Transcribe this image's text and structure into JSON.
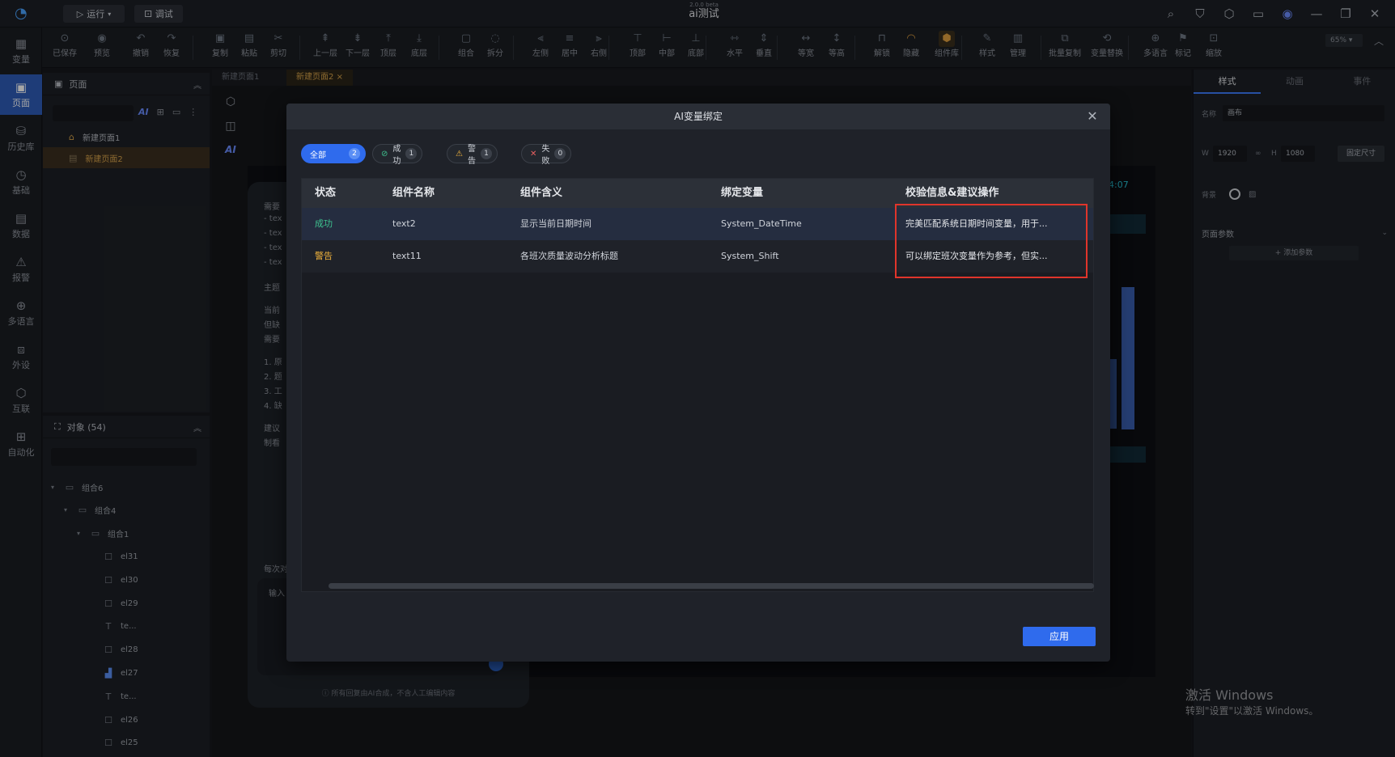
{
  "titlebar": {
    "version": "2.0.0 beta",
    "title": "ai测试",
    "run_label": "运行",
    "debug_label": "调试"
  },
  "toolbar": [
    {
      "label": "已保存",
      "icon": "save-icon"
    },
    {
      "label": "预览",
      "icon": "preview-icon"
    },
    {
      "label": "撤销",
      "icon": "undo-icon"
    },
    {
      "label": "恢复",
      "icon": "redo-icon"
    },
    {
      "label": "复制",
      "icon": "copy-icon"
    },
    {
      "label": "粘贴",
      "icon": "paste-icon"
    },
    {
      "label": "剪切",
      "icon": "cut-icon"
    },
    {
      "label": "上一层",
      "icon": "layer-up-icon"
    },
    {
      "label": "下一层",
      "icon": "layer-down-icon"
    },
    {
      "label": "顶层",
      "icon": "layer-top-icon"
    },
    {
      "label": "底层",
      "icon": "layer-bottom-icon"
    },
    {
      "label": "组合",
      "icon": "group-icon"
    },
    {
      "label": "拆分",
      "icon": "ungroup-icon"
    },
    {
      "label": "左侧",
      "icon": "align-left-icon"
    },
    {
      "label": "居中",
      "icon": "align-center-icon"
    },
    {
      "label": "右侧",
      "icon": "align-right-icon"
    },
    {
      "label": "顶部",
      "icon": "align-top-icon"
    },
    {
      "label": "中部",
      "icon": "align-middle-icon"
    },
    {
      "label": "底部",
      "icon": "align-bottom-icon"
    },
    {
      "label": "水平",
      "icon": "distribute-h-icon"
    },
    {
      "label": "垂直",
      "icon": "distribute-v-icon"
    },
    {
      "label": "等宽",
      "icon": "same-width-icon"
    },
    {
      "label": "等高",
      "icon": "same-height-icon"
    },
    {
      "label": "解锁",
      "icon": "unlock-icon"
    },
    {
      "label": "隐藏",
      "icon": "hide-icon"
    },
    {
      "label": "组件库",
      "icon": "component-lib-icon"
    },
    {
      "label": "样式",
      "icon": "style-icon"
    },
    {
      "label": "管理",
      "icon": "manage-icon"
    },
    {
      "label": "批量复制",
      "icon": "batch-copy-icon"
    },
    {
      "label": "变量替换",
      "icon": "var-replace-icon"
    },
    {
      "label": "多语言",
      "icon": "language-icon"
    },
    {
      "label": "标记",
      "icon": "mark-icon"
    },
    {
      "label": "缩放",
      "icon": "zoom-icon"
    }
  ],
  "zoom": "65%",
  "left_rail": [
    {
      "label": "变量",
      "icon": "variable-icon"
    },
    {
      "label": "页面",
      "icon": "page-icon"
    },
    {
      "label": "历史库",
      "icon": "history-icon"
    },
    {
      "label": "基础",
      "icon": "basic-icon"
    },
    {
      "label": "数据",
      "icon": "data-icon"
    },
    {
      "label": "报警",
      "icon": "alarm-icon"
    },
    {
      "label": "多语言",
      "icon": "language-icon"
    },
    {
      "label": "外设",
      "icon": "peripheral-icon"
    },
    {
      "label": "互联",
      "icon": "interconnect-icon"
    },
    {
      "label": "自动化",
      "icon": "automation-icon"
    }
  ],
  "pages_panel": {
    "title": "页面",
    "ai_label": "AI",
    "pages": [
      "新建页面1",
      "新建页面2"
    ]
  },
  "objects_panel": {
    "title": "对象 (54)",
    "tree": [
      {
        "label": "组合6",
        "level": 0,
        "icon": "folder-icon",
        "chev": "▾"
      },
      {
        "label": "组合4",
        "level": 1,
        "icon": "folder-icon",
        "chev": "▾"
      },
      {
        "label": "组合1",
        "level": 2,
        "icon": "folder-icon",
        "chev": "▾"
      },
      {
        "label": "el31",
        "level": 3,
        "icon": "rect-icon",
        "chev": ""
      },
      {
        "label": "el30",
        "level": 3,
        "icon": "rect-icon",
        "chev": ""
      },
      {
        "label": "el29",
        "level": 3,
        "icon": "rect-icon",
        "chev": ""
      },
      {
        "label": "te...",
        "level": 3,
        "icon": "text-icon",
        "chev": ""
      },
      {
        "label": "el28",
        "level": 3,
        "icon": "rect-icon",
        "chev": ""
      },
      {
        "label": "el27",
        "level": 3,
        "icon": "chart-icon",
        "chev": ""
      },
      {
        "label": "te...",
        "level": 3,
        "icon": "text-icon",
        "chev": ""
      },
      {
        "label": "el26",
        "level": 3,
        "icon": "rect-icon",
        "chev": ""
      },
      {
        "label": "el25",
        "level": 3,
        "icon": "rect-icon",
        "chev": ""
      }
    ]
  },
  "page_tabs": [
    {
      "label": "新建页面1",
      "active": false
    },
    {
      "label": "新建页面2",
      "active": true
    }
  ],
  "ai_chat": {
    "lines": [
      "需要",
      "- tex",
      "- tex",
      "- tex",
      "- tex",
      "主题",
      "当前",
      "但缺",
      "需要",
      "1. 原",
      "2. 题",
      "3. 工",
      "4. 缺",
      "建议",
      "制看"
    ],
    "side_text": "每次对",
    "input_placeholder": "输入",
    "footer": "ⓘ 所有回复由AI合成，不含人工编辑内容"
  },
  "background_time": "4:07",
  "right_panel": {
    "tabs": [
      "样式",
      "动画",
      "事件"
    ],
    "name_label": "名称",
    "name_value": "画布",
    "w_label": "W",
    "w_value": "1920",
    "h_label": "H",
    "h_value": "1080",
    "lock_icon": "link-icon",
    "fixed_size_label": "固定尺寸",
    "bg_label": "背景",
    "page_params_label": "页面参数",
    "add_param_label": "+ 添加参数"
  },
  "watermark": {
    "line1": "激活 Windows",
    "line2": "转到\"设置\"以激活 Windows。"
  },
  "modal": {
    "title": "AI变量绑定",
    "filters": [
      {
        "label": "全部",
        "count": "2",
        "active": true,
        "kind": "all"
      },
      {
        "label": "成功",
        "count": "1",
        "active": false,
        "kind": "success"
      },
      {
        "label": "警告",
        "count": "1",
        "active": false,
        "kind": "warning"
      },
      {
        "label": "失败",
        "count": "0",
        "active": false,
        "kind": "fail"
      }
    ],
    "columns": [
      "状态",
      "组件名称",
      "组件含义",
      "绑定变量",
      "校验信息&建议操作"
    ],
    "rows": [
      {
        "status": "成功",
        "status_kind": "success",
        "name": "text2",
        "meaning": "显示当前日期时间",
        "variable": "System_DateTime",
        "message": "完美匹配系统日期时间变量，用于..."
      },
      {
        "status": "警告",
        "status_kind": "warning",
        "name": "text11",
        "meaning": "各班次质量波动分析标题",
        "variable": "System_Shift",
        "message": "可以绑定班次变量作为参考，但实..."
      }
    ],
    "apply_label": "应用"
  },
  "colors": {
    "accent": "#2f6bed",
    "success": "#3ec28f",
    "warning": "#f0b33c",
    "fail": "#e86060",
    "highlight": "#e0352b",
    "nav_active": "#2e5db8"
  }
}
